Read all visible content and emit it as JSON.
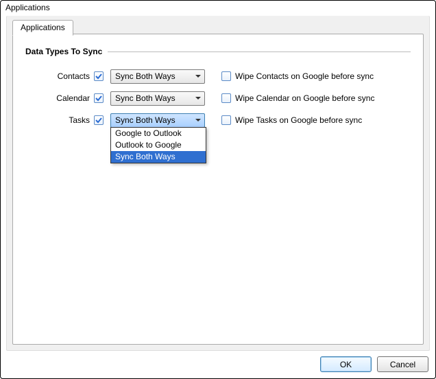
{
  "window": {
    "title": "Applications"
  },
  "tab": {
    "label": "Applications"
  },
  "section": {
    "title": "Data Types To Sync"
  },
  "rows": {
    "contacts": {
      "label": "Contacts",
      "checked": true,
      "mode": "Sync Both Ways",
      "wipe_label": "Wipe Contacts on Google before sync",
      "wipe_checked": false
    },
    "calendar": {
      "label": "Calendar",
      "checked": true,
      "mode": "Sync Both Ways",
      "wipe_label": "Wipe Calendar on Google before sync",
      "wipe_checked": false
    },
    "tasks": {
      "label": "Tasks",
      "checked": true,
      "mode": "Sync Both Ways",
      "wipe_label": "Wipe Tasks on Google before sync",
      "wipe_checked": false
    }
  },
  "tasks_dropdown": {
    "options": [
      "Google to Outlook",
      "Outlook to Google",
      "Sync Both Ways"
    ],
    "selected_index": 2
  },
  "buttons": {
    "ok": "OK",
    "cancel": "Cancel"
  }
}
